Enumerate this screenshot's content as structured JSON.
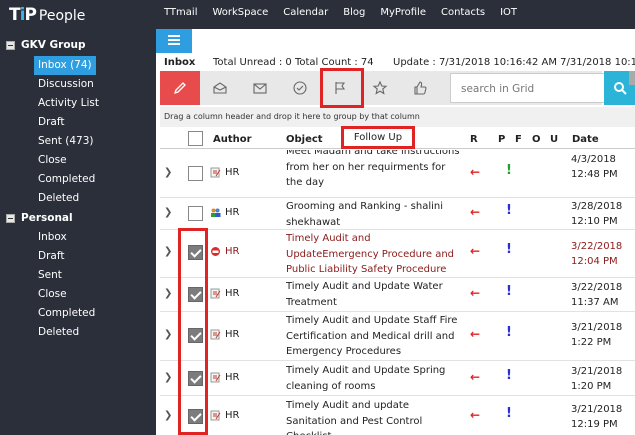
{
  "app": {
    "logo_tip": "TiP",
    "logo_people": "People"
  },
  "topnav": [
    "TTmail",
    "WorkSpace",
    "Calendar",
    "Blog",
    "MyProfile",
    "Contacts",
    "IOT"
  ],
  "sidebar": {
    "groups": [
      {
        "label": "GKV Group",
        "items": [
          "Inbox (74)",
          "Discussion",
          "Activity List",
          "Draft",
          "Sent (473)",
          "Close",
          "Completed",
          "Deleted"
        ],
        "active": 0
      },
      {
        "label": "Personal",
        "items": [
          "Inbox",
          "Draft",
          "Sent",
          "Close",
          "Completed",
          "Deleted"
        ]
      }
    ]
  },
  "infobar": {
    "folder": "Inbox",
    "totals": "Total Unread : 0 Total Count : 74",
    "update": "Update :  7/31/2018 10:16:42 AM 7/31/2018 10:16:4"
  },
  "toolbar": {
    "tooltip": "Follow Up",
    "search_placeholder": "search in Grid"
  },
  "dragbar": "Drag a column header and drop it here to group by that column",
  "headers": {
    "author": "Author",
    "object": "Object",
    "r": "R",
    "p": "P",
    "f": "F",
    "o": "O",
    "u": "U",
    "date": "Date"
  },
  "rows": [
    {
      "checked": false,
      "icon": "note",
      "author": "HR",
      "object": "Meet Madam and take instructions from her on her requirments for the day",
      "flag_color": "#1fa12f",
      "date": "4/3/2018",
      "time": "12:48 PM"
    },
    {
      "checked": false,
      "icon": "people",
      "author": "HR",
      "object": "Grooming and Ranking - shalini shekhawat",
      "flag_color": "#2a2fd8",
      "date": "3/28/2018",
      "time": "12:10 PM"
    },
    {
      "checked": true,
      "icon": "alert",
      "author": "HR",
      "object": "Timely Audit and UpdateEmergency Procedure and Public Liability Safety Procedure",
      "flag_color": "#2a2fd8",
      "date": "3/22/2018",
      "time": "12:04 PM",
      "maroon": true
    },
    {
      "checked": true,
      "icon": "note",
      "author": "HR",
      "object": "Timely Audit and Update Water Treatment",
      "flag_color": "#2a2fd8",
      "date": "3/22/2018",
      "time": "11:37 AM"
    },
    {
      "checked": true,
      "icon": "note",
      "author": "HR",
      "object": "Timely Audit and Update Staff Fire Certification and Medical drill and Emergency Procedures",
      "flag_color": "#2a2fd8",
      "date": "3/21/2018",
      "time": "1:22 PM"
    },
    {
      "checked": true,
      "icon": "note",
      "author": "HR",
      "object": "Timely Audit and Update Spring cleaning of rooms",
      "flag_color": "#2a2fd8",
      "date": "3/21/2018",
      "time": "1:20 PM"
    },
    {
      "checked": true,
      "icon": "note",
      "author": "HR",
      "object": "Timely Audit and update Sanitation and Pest Control Checklist",
      "flag_color": "#2a2fd8",
      "date": "3/21/2018",
      "time": "12:19 PM"
    }
  ]
}
